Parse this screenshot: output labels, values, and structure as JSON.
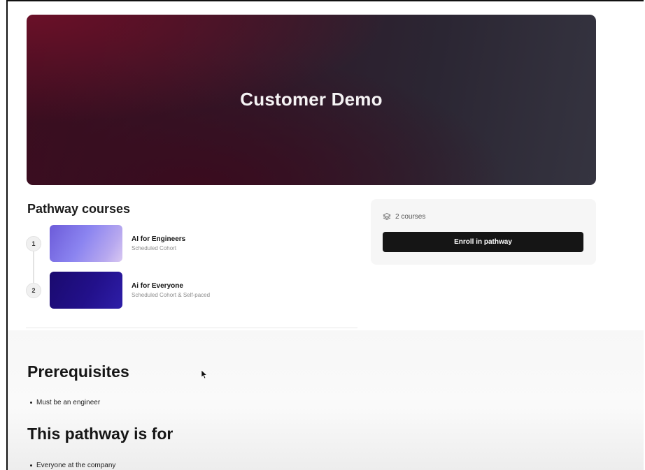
{
  "hero": {
    "title": "Customer Demo"
  },
  "pathway": {
    "heading": "Pathway courses",
    "courses": [
      {
        "number": "1",
        "title": "AI for Engineers",
        "subtitle": "Scheduled Cohort"
      },
      {
        "number": "2",
        "title": "Ai for Everyone",
        "subtitle": "Scheduled Cohort & Self-paced"
      }
    ]
  },
  "enroll": {
    "course_count": "2 courses",
    "button_label": "Enroll in pathway"
  },
  "prerequisites": {
    "heading": "Prerequisites",
    "items": [
      "Must be an engineer"
    ]
  },
  "audience": {
    "heading": "This pathway is for",
    "items": [
      "Everyone at the company"
    ]
  },
  "icons": {
    "course_count": "layers-icon",
    "cursor": "mouse-pointer-icon"
  },
  "colors": {
    "button_bg": "#151515",
    "hero_start": "#6a1028",
    "hero_end": "#353440",
    "thumb_1": "#8b84f0",
    "thumb_2": "#22108a"
  }
}
